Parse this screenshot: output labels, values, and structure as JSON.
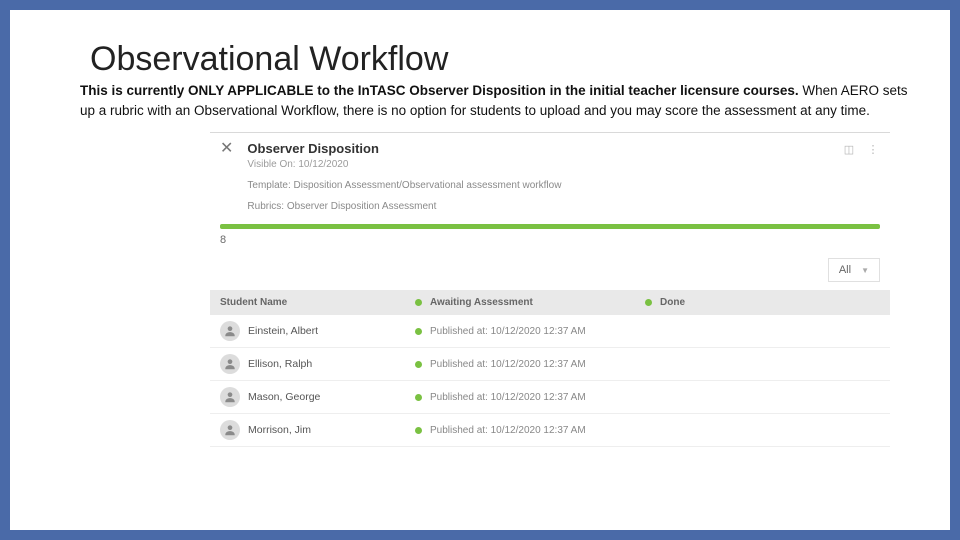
{
  "slide": {
    "title": "Observational Workflow",
    "desc_bold": "This is currently ONLY APPLICABLE to the InTASC Observer Disposition in the initial teacher licensure courses.",
    "desc_rest": " When AERO sets up a rubric with an Observational Workflow, there is no option for students to upload and you may score the assessment at any time."
  },
  "shot": {
    "title": "Observer Disposition",
    "visible_on": "Visible On: 10/12/2020",
    "template": "Template: Disposition Assessment/Observational assessment workflow",
    "rubrics": "Rubrics: Observer Disposition Assessment",
    "count": "8",
    "filter_label": "All",
    "columns": {
      "student": "Student Name",
      "awaiting": "Awaiting Assessment",
      "done": "Done"
    },
    "students": [
      {
        "name": "Einstein, Albert",
        "published": "Published at: 10/12/2020 12:37 AM"
      },
      {
        "name": "Ellison, Ralph",
        "published": "Published at: 10/12/2020 12:37 AM"
      },
      {
        "name": "Mason, George",
        "published": "Published at: 10/12/2020 12:37 AM"
      },
      {
        "name": "Morrison, Jim",
        "published": "Published at: 10/12/2020 12:37 AM"
      }
    ]
  }
}
